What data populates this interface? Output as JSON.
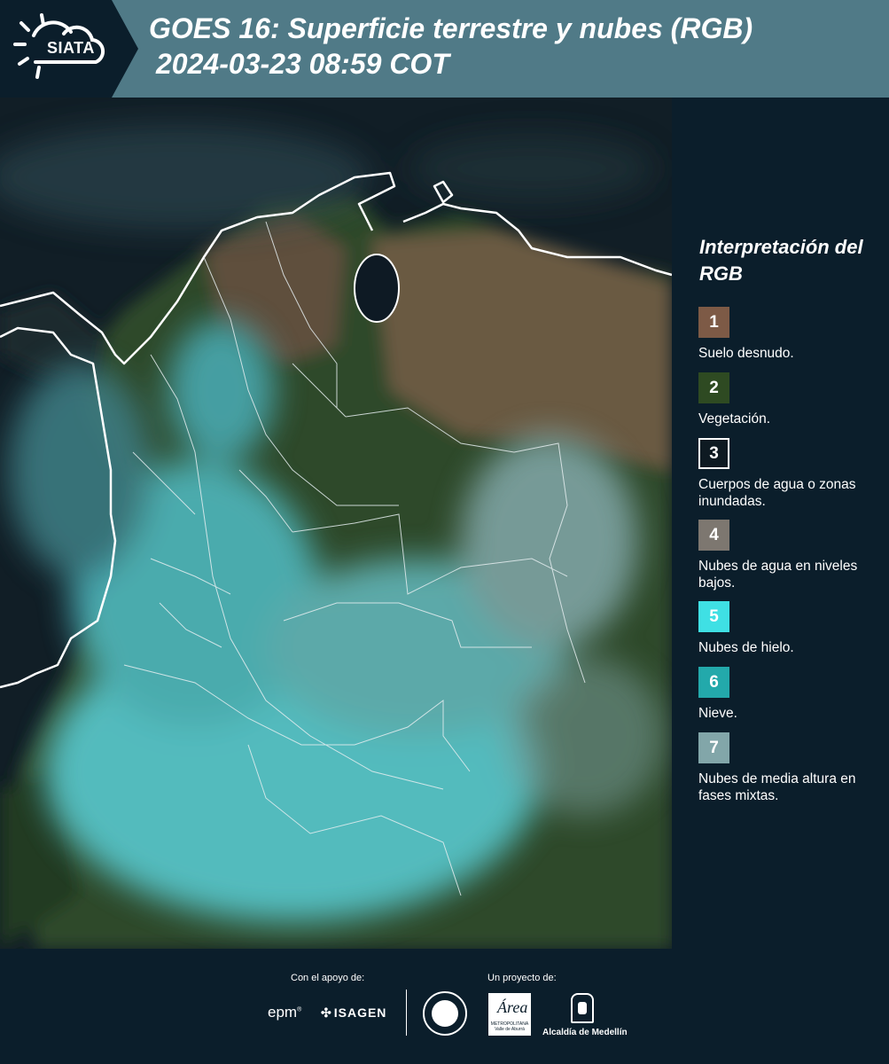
{
  "header": {
    "logo_text": "SIATA",
    "title_line1": "GOES 16: Superficie terrestre y nubes (RGB)",
    "title_line2": "2024-03-23 08:59 COT",
    "background_color": "#507a87"
  },
  "legend": {
    "title": "Interpretación del RGB",
    "items": [
      {
        "number": "1",
        "label": "Suelo desnudo.",
        "color": "#7d5a46"
      },
      {
        "number": "2",
        "label": "Vegetación.",
        "color": "#2e4a22"
      },
      {
        "number": "3",
        "label": "Cuerpos de agua o zonas inundadas.",
        "color": "#0e1a22"
      },
      {
        "number": "4",
        "label": "Nubes de agua en niveles bajos.",
        "color": "#7d7770"
      },
      {
        "number": "5",
        "label": "Nubes de hielo.",
        "color": "#3fe0e4"
      },
      {
        "number": "6",
        "label": "Nieve.",
        "color": "#23a9ab"
      },
      {
        "number": "7",
        "label": "Nubes de media altura en fases mixtas.",
        "color": "#82a6a9"
      }
    ]
  },
  "footer": {
    "support_label": "Con el apoyo de:",
    "project_label": "Un proyecto de:",
    "sponsor_epm": "epm",
    "sponsor_isagen": "ISAGEN",
    "area_logo_text": "Área",
    "area_logo_sub": "METROPOLITANA Valle de Aburrá",
    "alcaldia_label": "Alcaldía de Medellín"
  },
  "icons": {
    "logo": "sun-cloud-icon",
    "isagen_mark": "windmill-icon",
    "seal": "municipal-seal-icon",
    "alcaldia": "coat-of-arms-icon"
  }
}
